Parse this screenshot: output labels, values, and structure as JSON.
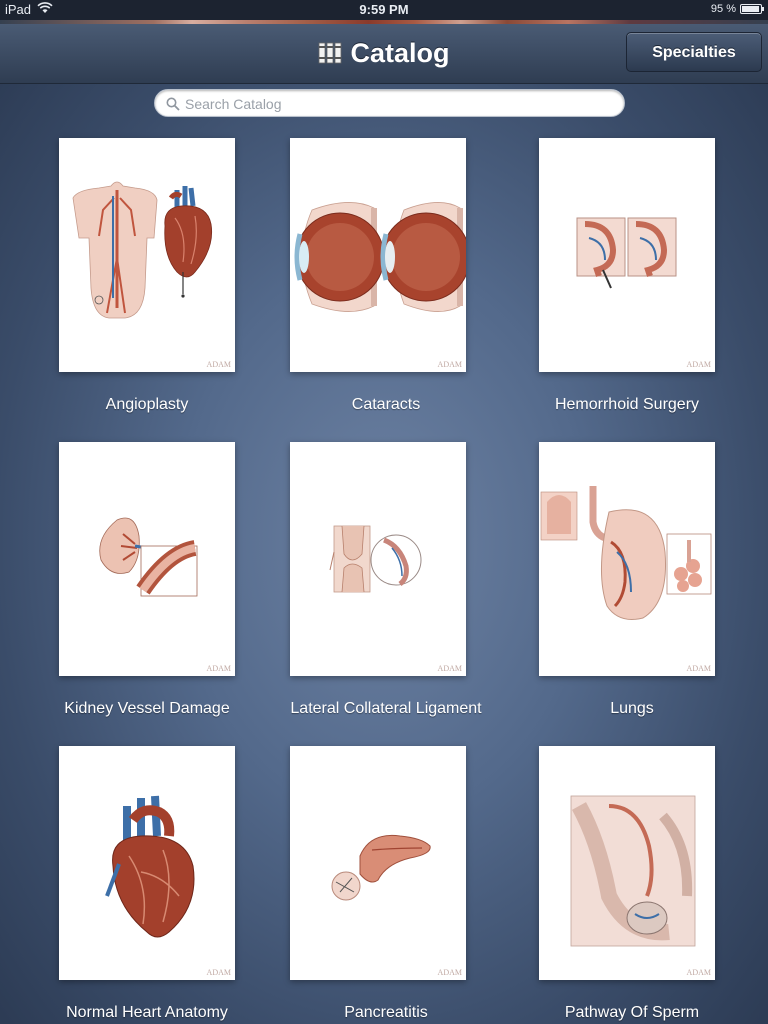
{
  "status_bar": {
    "device": "iPad",
    "time": "9:59 PM",
    "battery_text": "95 %",
    "battery_level": 0.95
  },
  "nav": {
    "title": "Catalog",
    "title_icon": "books-icon",
    "right_button": "Specialties"
  },
  "search": {
    "placeholder": "Search Catalog",
    "value": ""
  },
  "catalog": {
    "watermark": "ADAM",
    "items": [
      {
        "title": "Angioplasty"
      },
      {
        "title": "Cataracts"
      },
      {
        "title": "Hemorrhoid Surgery"
      },
      {
        "title": "Kidney Vessel Damage"
      },
      {
        "title": "Lateral Collateral Ligament"
      },
      {
        "title": "Lungs"
      },
      {
        "title": "Normal Heart Anatomy"
      },
      {
        "title": "Pancreatitis"
      },
      {
        "title": "Pathway Of Sperm"
      }
    ]
  },
  "colors": {
    "accent_red": "#a3402c",
    "vessel_blue": "#3d6fa8",
    "background": "#53698b"
  }
}
